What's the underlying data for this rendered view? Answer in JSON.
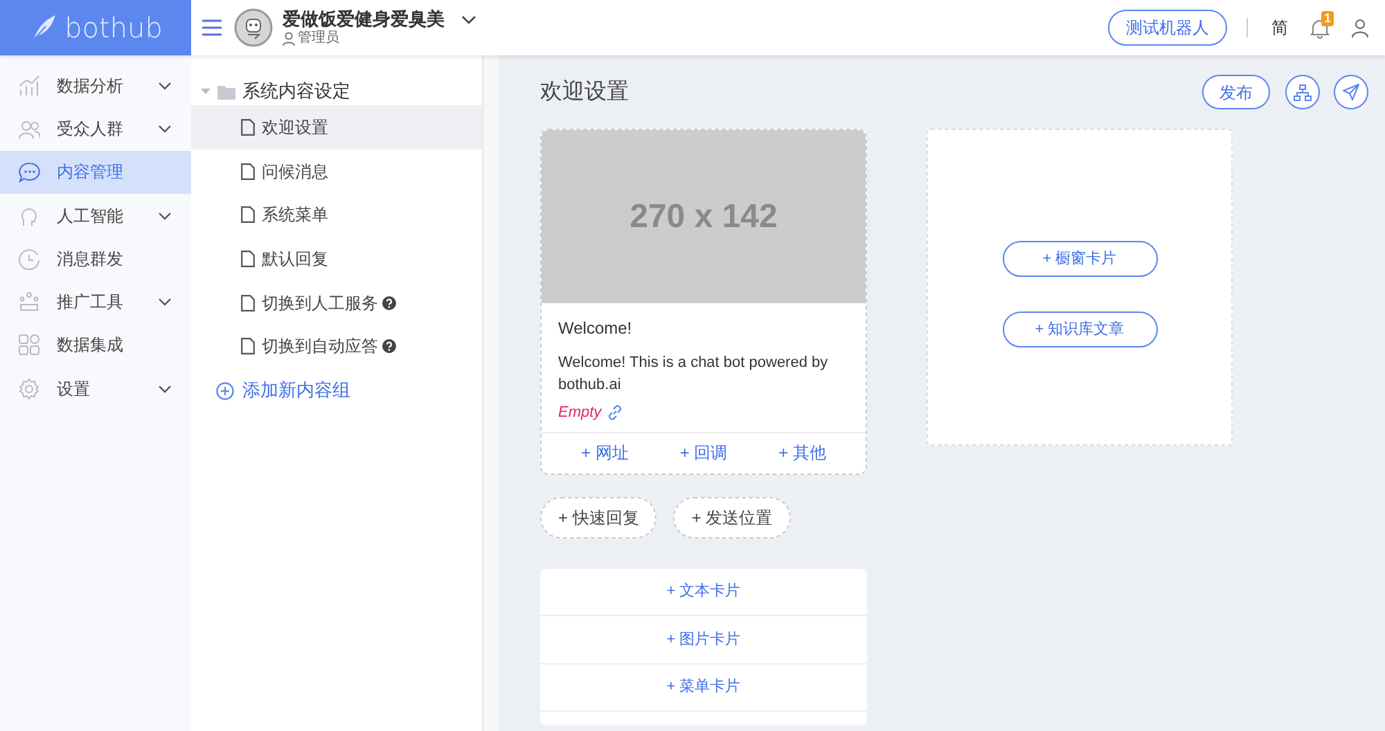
{
  "logo": {
    "text": "bothub"
  },
  "sidebar": {
    "items": [
      {
        "label": "数据分析",
        "selected": false,
        "expandable": true
      },
      {
        "label": "受众人群",
        "selected": false,
        "expandable": true
      },
      {
        "label": "内容管理",
        "selected": true,
        "expandable": false
      },
      {
        "label": "人工智能",
        "selected": false,
        "expandable": true
      },
      {
        "label": "消息群发",
        "selected": false,
        "expandable": false
      },
      {
        "label": "推广工具",
        "selected": false,
        "expandable": true
      },
      {
        "label": "数据集成",
        "selected": false,
        "expandable": false
      },
      {
        "label": "设置",
        "selected": false,
        "expandable": true
      }
    ]
  },
  "header": {
    "bot_name": "爱做饭爱健身爱臭美",
    "role": "管理员",
    "test_button": "测试机器人",
    "language": "简",
    "notification_count": "1"
  },
  "tree": {
    "folder": {
      "label": "系统内容设定",
      "expanded": true,
      "children": [
        {
          "label": "欢迎设置",
          "selected": true,
          "help": false
        },
        {
          "label": "问候消息",
          "selected": false,
          "help": false
        },
        {
          "label": "系统菜单",
          "selected": false,
          "help": false
        },
        {
          "label": "默认回复",
          "selected": false,
          "help": false
        },
        {
          "label": "切换到人工服务",
          "selected": false,
          "help": true
        },
        {
          "label": "切换到自动应答",
          "selected": false,
          "help": true
        }
      ]
    },
    "add_group": "添加新内容组"
  },
  "main": {
    "title": "欢迎设置",
    "publish_button": "发布",
    "card": {
      "image_label": "270 x 142",
      "title": "Welcome!",
      "text": "Welcome! This is a chat bot powered by bothub.ai",
      "empty_label": "Empty",
      "links": [
        "+ 网址",
        "+ 回调",
        "+ 其他"
      ]
    },
    "side_panel_buttons": [
      "+ 橱窗卡片",
      "+ 知识库文章"
    ],
    "quick_buttons": [
      "+ 快速回复",
      "+ 发送位置"
    ],
    "add_cards": [
      "+ 文本卡片",
      "+ 图片卡片",
      "+ 菜单卡片"
    ]
  }
}
